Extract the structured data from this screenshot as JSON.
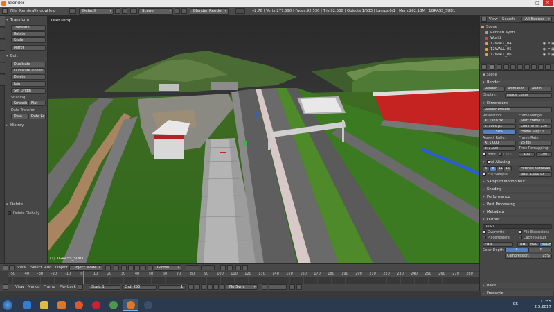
{
  "window": {
    "title": "Blender",
    "minimize": "–",
    "maximize": "□",
    "close": "✕"
  },
  "infobar": {
    "menus": [
      "File",
      "Render",
      "Window",
      "Help"
    ],
    "layout": "Default",
    "scene": "Scene",
    "engine": "Blender Render",
    "stats": "v2.78 | Verts:277,590 | Faces:92,530 | Tris:92,530 | Objects:1/533 | Lamps:0/1 | Mem:262.13M | 1GRASS_SUB1"
  },
  "toolshelf": {
    "transform": {
      "header": "Transform",
      "buttons": [
        "Translate",
        "Rotate",
        "Scale",
        "Mirror"
      ]
    },
    "edit": {
      "header": "Edit",
      "buttons": [
        "Duplicate",
        "Duplicate Linked",
        "Delete",
        "Join"
      ],
      "set_origin": "Set Origin"
    },
    "shading": {
      "label": "Shading:",
      "smooth": "Smooth",
      "flat": "Flat"
    },
    "data_transfer": {
      "label": "Data Transfer:",
      "data": "Data",
      "data_layout": "Data Layo"
    },
    "history": "History",
    "delete_panel": {
      "header": "Delete",
      "item": "Delete Globally"
    }
  },
  "viewport": {
    "label": "User Persp",
    "object": "(1) 1GRASS_SUB1"
  },
  "view3d_header": {
    "menus": [
      "View",
      "Select",
      "Add",
      "Object"
    ],
    "mode": "Object Mode",
    "orientation": "Global"
  },
  "timeline": {
    "ruler": [
      "-50",
      "-40",
      "-30",
      "-20",
      "-10",
      "0",
      "10",
      "20",
      "30",
      "40",
      "50",
      "60",
      "70",
      "80",
      "90",
      "100",
      "110",
      "120",
      "130",
      "140",
      "150",
      "160",
      "170",
      "180",
      "190",
      "200",
      "210",
      "220",
      "230",
      "240",
      "250",
      "260",
      "270",
      "280"
    ],
    "current_frame": 1,
    "menus": [
      "View",
      "Marker",
      "Frame",
      "Playback"
    ],
    "start": "Start:",
    "start_val": "1",
    "end": "End:",
    "end_val": "250",
    "frame": "1",
    "sync": "No Sync"
  },
  "outliner": {
    "menus": [
      "View",
      "Search"
    ],
    "filter": "All Scenes",
    "rows": [
      "Scene",
      "RenderLayers",
      "World",
      "12WALL_04",
      "12WALL_05",
      "12WALL_06"
    ]
  },
  "properties": {
    "scene": "Scene",
    "render_header": "Render",
    "render_btn": "Render",
    "animation_btn": "Animation",
    "audio_btn": "Audio",
    "display_label": "Display:",
    "display_val": "Image Editor",
    "dimensions": "Dimensions",
    "render_presets": "Render Presets",
    "resolution": "Resolution:",
    "res_x": "X:    1920 px",
    "res_y": "Y:    1080 px",
    "res_pct": "50%",
    "frame_range": "Frame Range:",
    "start_frame": "Start Frame:   1",
    "end_frame": "End Frame:  250",
    "frame_step": "Frame Step:   1",
    "aspect_ratio": "Aspect Ratio:",
    "asp_x": "X:    1.000",
    "asp_y": "Y:    1.000",
    "frame_rate": "Frame Rate:",
    "fps": "25 fps",
    "time_remapping": "Time Remapping:",
    "remap_old": "100",
    "remap_new": "100",
    "border": "Bord",
    "crop": "Crop",
    "anti_aliasing": "Anti-Aliasing",
    "aa_samples": [
      "5",
      "8",
      "11",
      "16"
    ],
    "aa_filter": "Mitchell-Netravali",
    "full_sample": "Full Sample",
    "aa_size": "Size:  1.000 px",
    "sampled_motion_blur": "Sampled Motion Blur",
    "shading": "Shading",
    "performance": "Performance",
    "post_processing": "Post Processing",
    "metadata": "Metadata",
    "output": "Output",
    "output_path": "/tmp\\",
    "overwrite": "Overwrite",
    "file_extensions": "File Extensions",
    "placeholders": "Placeholders",
    "cache_result": "Cache Result",
    "format": "PNG",
    "bw": "BW",
    "rgb": "RGB",
    "rgba": "RGBA",
    "color_depth": "Color Depth:",
    "depth8": "8",
    "depth16": "16",
    "compression": "Compression:",
    "compression_val": "15%",
    "bake": "Bake",
    "freestyle": "Freestyle"
  },
  "taskbar": {
    "lang": "CS",
    "time": "11:55",
    "date": "2.3.2017"
  }
}
